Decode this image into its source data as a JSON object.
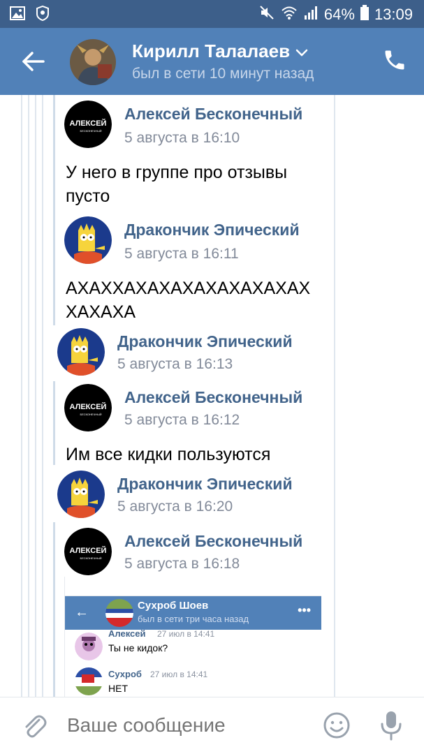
{
  "status_bar": {
    "battery": "64%",
    "time": "13:09"
  },
  "header": {
    "name": "Кирилл Талалаев",
    "status": "был в сети 10 минут назад"
  },
  "messages": [
    {
      "author": "Алексей Бесконечный",
      "date": "5 августа в 16:10",
      "text_lines": [
        "У него в группе про отзывы",
        "пусто"
      ],
      "avatar_label": "АЛЕКСЕЙ",
      "avatar_sub": "БЕСКОНЕЧНЫЙ"
    },
    {
      "author": "Дракончик Эпический",
      "date": "5 августа в 16:11",
      "text_lines": [
        "АХАХХАХАХАХАХАХАХАХАХ",
        "ХАХАХА"
      ]
    },
    {
      "author": "Дракончик Эпический",
      "date": "5 августа в 16:13"
    },
    {
      "author": "Алексей Бесконечный",
      "date": "5 августа в 16:12",
      "text_lines": [
        "Им все кидки пользуются"
      ],
      "avatar_label": "АЛЕКСЕЙ",
      "avatar_sub": "БЕСКОНЕЧНЫЙ"
    },
    {
      "author": "Дракончик Эпический",
      "date": "5 августа в 16:20"
    },
    {
      "author": "Алексей Бесконечный",
      "date": "5 августа в 16:18",
      "avatar_label": "АЛЕКСЕЙ",
      "avatar_sub": "БЕСКОНЕЧНЫЙ"
    }
  ],
  "screenshot": {
    "name": "Сухроб Шоев",
    "status": "был в сети три часа назад",
    "messages": [
      {
        "author": "Алексей",
        "time": "27 июл в 14:41",
        "text": "Ты не кидок?"
      },
      {
        "author": "Сухроб",
        "time": "27 июл в 14:41",
        "text": "НЕТ"
      }
    ]
  },
  "composer": {
    "placeholder": "Ваше сообщение"
  },
  "colors": {
    "header_bg": "#5181b8",
    "status_bg": "#3d5f8a",
    "author": "#42648b",
    "date": "#828a99"
  }
}
